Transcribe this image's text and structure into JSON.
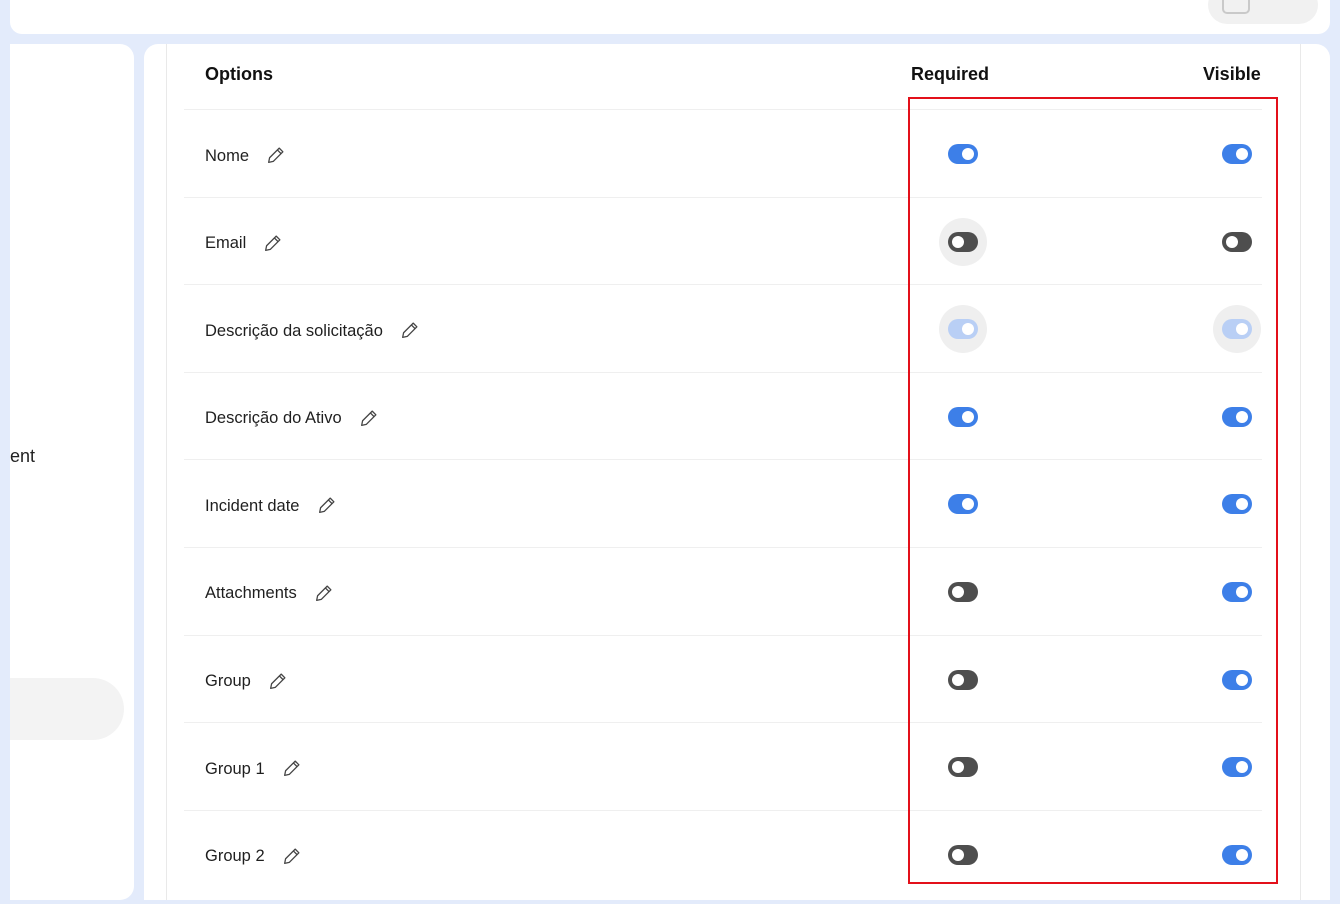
{
  "table": {
    "headers": {
      "options": "Options",
      "required": "Required",
      "visible": "Visible"
    },
    "rows": [
      {
        "label": "Nome",
        "required": "on",
        "visible": "on"
      },
      {
        "label": "Email",
        "required": "off",
        "visible": "off"
      },
      {
        "label": "Descrição da solicitação",
        "required": "disabled",
        "visible": "disabled"
      },
      {
        "label": "Descrição do Ativo",
        "required": "on",
        "visible": "on"
      },
      {
        "label": "Incident date",
        "required": "on",
        "visible": "on"
      },
      {
        "label": "Attachments",
        "required": "off",
        "visible": "on"
      },
      {
        "label": "Group",
        "required": "off",
        "visible": "on"
      },
      {
        "label": "Group 1",
        "required": "off",
        "visible": "on"
      },
      {
        "label": "Group 2",
        "required": "off",
        "visible": "on"
      }
    ]
  },
  "sidebar": {
    "truncated_text": "ent"
  },
  "icons": {
    "edit": "pencil-icon"
  },
  "colors": {
    "accent": "#3d7fe8",
    "toggle_off": "#4e4e4e",
    "toggle_disabled": "#b9cff5",
    "highlight": "#e3101a",
    "background": "#e3ebfb"
  }
}
